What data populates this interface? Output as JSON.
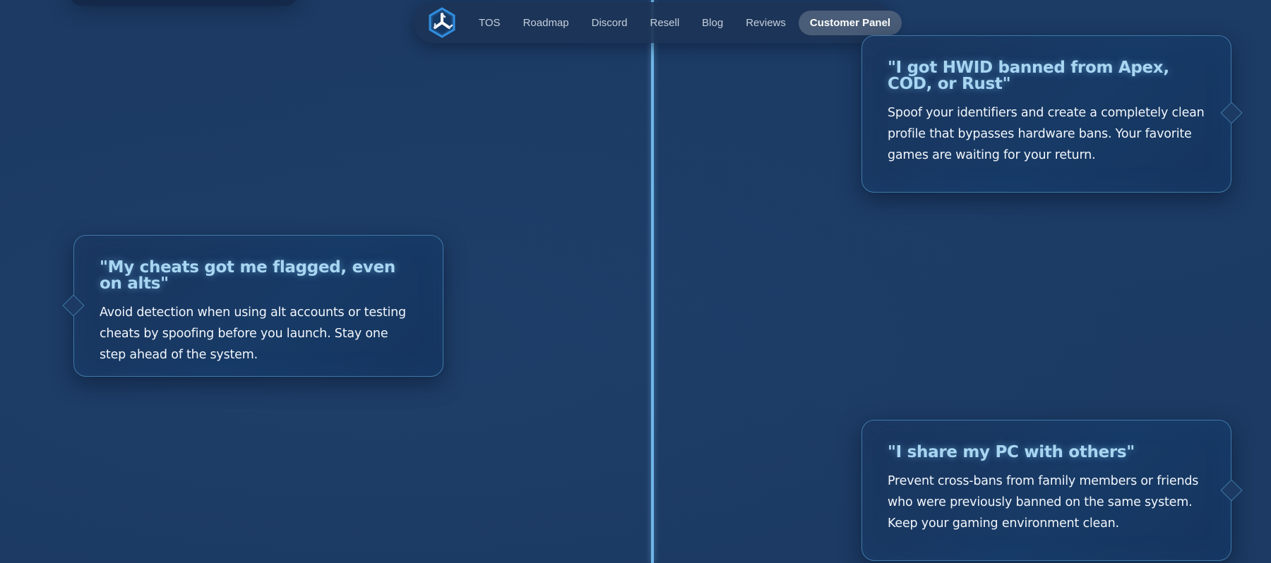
{
  "nav": {
    "logo_icon": "cube-logo-icon",
    "links": [
      "TOS",
      "Roadmap",
      "Discord",
      "Resell",
      "Blog",
      "Reviews"
    ],
    "cta": "Customer Panel"
  },
  "colors": {
    "background": "#1c3a63",
    "accent": "#6fb6e8",
    "card_title": "#a8d6f2",
    "card_border": "#3f79a8"
  },
  "cards": [
    {
      "title": "\"I got HWID banned from Apex, COD, or Rust\"",
      "body": "Spoof your identifiers and create a completely clean profile that bypasses hardware bans. Your favorite games are waiting for your return."
    },
    {
      "title": "\"My cheats got me flagged, even on alts\"",
      "body": "Avoid detection when using alt accounts or testing cheats by spoofing before you launch. Stay one step ahead of the system."
    },
    {
      "title": "\"I share my PC with others\"",
      "body": "Prevent cross-bans from family members or friends who were previously banned on the same system. Keep your gaming environment clean."
    }
  ]
}
